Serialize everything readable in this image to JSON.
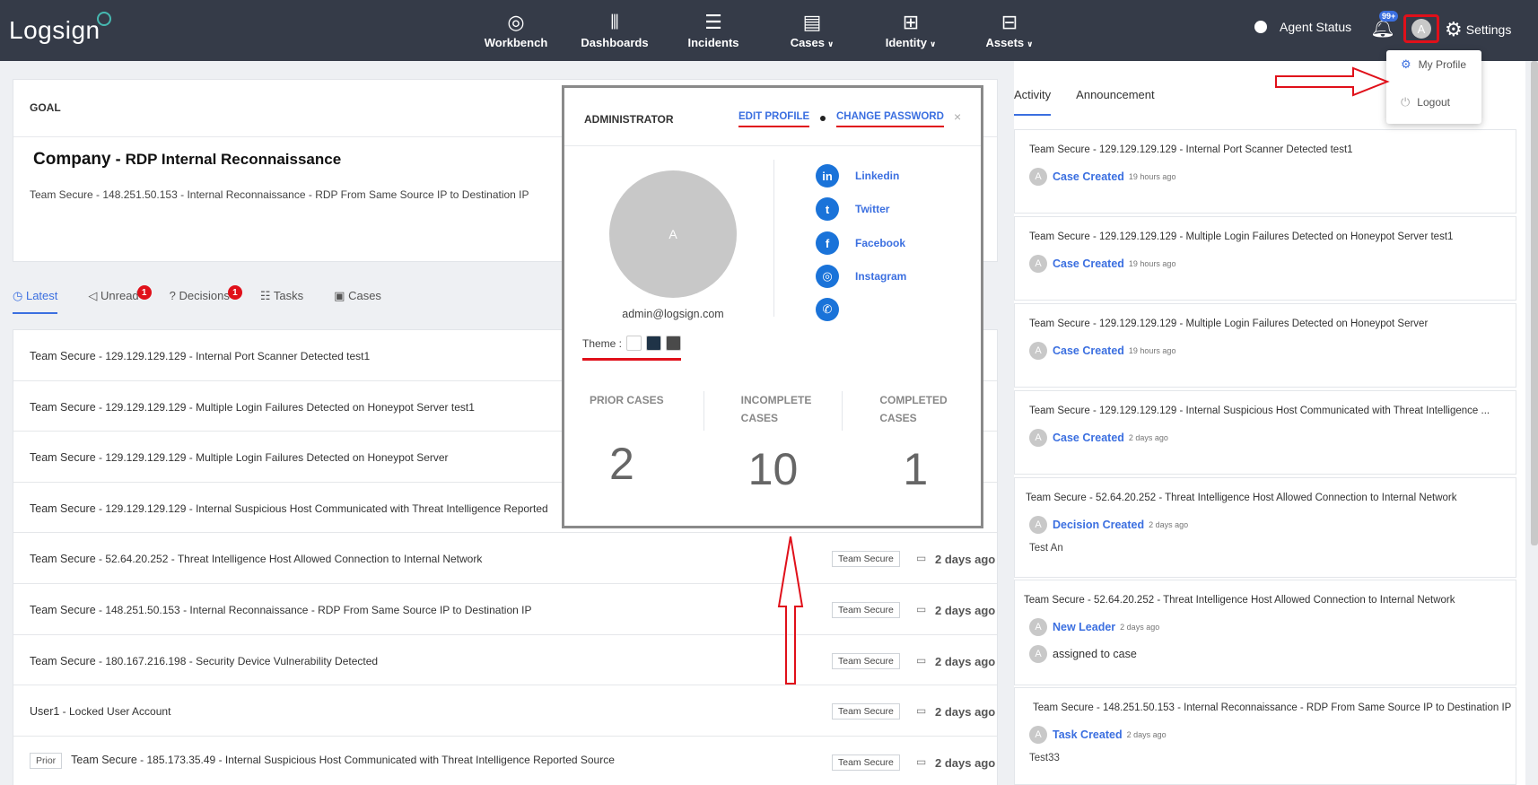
{
  "brand": {
    "logo": "Logsign"
  },
  "nav": [
    {
      "label": "Workbench",
      "icon": "speedometer-icon",
      "glyph": "◎",
      "dropdown": false
    },
    {
      "label": "Dashboards",
      "icon": "bar-chart-icon",
      "glyph": "⫴",
      "dropdown": false
    },
    {
      "label": "Incidents",
      "icon": "list-icon",
      "glyph": "☰",
      "dropdown": false
    },
    {
      "label": "Cases",
      "icon": "file-cabinet-icon",
      "glyph": "▤",
      "dropdown": true
    },
    {
      "label": "Identity",
      "icon": "network-icon",
      "glyph": "⊞",
      "dropdown": true
    },
    {
      "label": "Assets",
      "icon": "grid-icon",
      "glyph": "⊟",
      "dropdown": true
    }
  ],
  "header": {
    "agent_status": "Agent Status",
    "notifications_badge": "99+",
    "avatar_letter": "A",
    "settings": "Settings"
  },
  "dropdown": {
    "my_profile": "My Profile",
    "logout": "Logout"
  },
  "goal": {
    "heading": "GOAL",
    "title_company": "Company",
    "title_dash": " - ",
    "title_rest": "RDP Internal Reconnaissance",
    "desc_org": "Team Secure",
    "desc_rest": " - 148.251.50.153 - Internal Reconnaissance - RDP From Same Source IP to Destination IP"
  },
  "tabs": [
    {
      "label": "Latest",
      "icon": "clock-icon",
      "glyph": "◷",
      "badge": ""
    },
    {
      "label": "Unread",
      "icon": "megaphone-icon",
      "glyph": "◁",
      "badge": "1"
    },
    {
      "label": "Decisions",
      "icon": "question-icon",
      "glyph": "?",
      "badge": "1"
    },
    {
      "label": "Tasks",
      "icon": "tasks-icon",
      "glyph": "☷",
      "badge": ""
    },
    {
      "label": "Cases",
      "icon": "case-icon",
      "glyph": "▣",
      "badge": ""
    }
  ],
  "rows": [
    {
      "prefix": "",
      "org": "Team Secure",
      "rest": " - 129.129.129.129 - Internal Port Scanner Detected test1",
      "tag": "",
      "age": ""
    },
    {
      "prefix": "",
      "org": "Team Secure",
      "rest": " - 129.129.129.129 - Multiple Login Failures Detected on Honeypot Server test1",
      "tag": "",
      "age": ""
    },
    {
      "prefix": "",
      "org": "Team Secure",
      "rest": " - 129.129.129.129 - Multiple Login Failures Detected on Honeypot Server",
      "tag": "",
      "age": ""
    },
    {
      "prefix": "",
      "org": "Team Secure",
      "rest": " - 129.129.129.129 - Internal Suspicious Host Communicated with Threat Intelligence Reported",
      "tag": "",
      "age": ""
    },
    {
      "prefix": "",
      "org": "Team Secure",
      "rest": " - 52.64.20.252 - Threat Intelligence Host Allowed Connection to Internal Network",
      "tag": "Team Secure",
      "age": "2 days ago"
    },
    {
      "prefix": "",
      "org": "Team Secure",
      "rest": " - 148.251.50.153 - Internal Reconnaissance - RDP From Same Source IP to Destination IP",
      "tag": "Team Secure",
      "age": "2 days ago"
    },
    {
      "prefix": "",
      "org": "Team Secure",
      "rest": " - 180.167.216.198 - Security Device Vulnerability Detected",
      "tag": "Team Secure",
      "age": "2 days ago"
    },
    {
      "prefix": "",
      "org": "User1",
      "rest": " - Locked User Account",
      "tag": "Team Secure",
      "age": "2 days ago"
    },
    {
      "prefix": "Prior",
      "org": "Team Secure",
      "rest": "  - 185.173.35.49 - Internal Suspicious Host Communicated with Threat Intelligence Reported Source",
      "tag": "Team Secure",
      "age": "2 days ago"
    }
  ],
  "right_tabs": {
    "activity": "Activity",
    "announcement": "Announcement"
  },
  "activities": [
    {
      "title": "Team Secure - 129.129.129.129 - Internal Port Scanner Detected test1",
      "event": "Case Created",
      "time": "19 hours ago",
      "note": "",
      "assign": ""
    },
    {
      "title": "Team Secure - 129.129.129.129 - Multiple Login Failures Detected on Honeypot Server test1",
      "event": "Case Created",
      "time": "19 hours ago",
      "note": "",
      "assign": ""
    },
    {
      "title": "Team Secure - 129.129.129.129 - Multiple Login Failures Detected on Honeypot Server",
      "event": "Case Created",
      "time": "19 hours ago",
      "note": "",
      "assign": ""
    },
    {
      "title": "Team Secure - 129.129.129.129 - Internal Suspicious Host Communicated with Threat Intelligence ...",
      "event": "Case Created",
      "time": "2 days ago",
      "note": "",
      "assign": ""
    },
    {
      "title": "Team Secure - 52.64.20.252 - Threat Intelligence Host Allowed Connection to Internal Network",
      "event": "Decision Created",
      "time": "2 days ago",
      "note": "Test An",
      "assign": ""
    },
    {
      "title": "Team Secure  - 52.64.20.252 - Threat Intelligence Host Allowed Connection to Internal Network",
      "event": "New Leader",
      "time": "2 days ago",
      "note": "",
      "assign": "assigned to case"
    },
    {
      "title": "Team Secure - 148.251.50.153 - Internal Reconnaissance - RDP From Same Source IP to Destination IP",
      "event": "Task Created",
      "time": "2 days ago",
      "note": "Test33",
      "assign": ""
    }
  ],
  "profile": {
    "role": "ADMINISTRATOR",
    "edit_profile": "EDIT PROFILE",
    "change_password": "CHANGE PASSWORD",
    "close": "×",
    "avatar_letter": "A",
    "email": "admin@logsign.com",
    "theme_label": "Theme :",
    "theme_colors": [
      "#ffffff",
      "#1f3347",
      "#4a4a4a"
    ],
    "social": [
      {
        "label": "Linkedin",
        "icon": "linkedin-icon",
        "glyph": "in"
      },
      {
        "label": "Twitter",
        "icon": "twitter-icon",
        "glyph": "t"
      },
      {
        "label": "Facebook",
        "icon": "facebook-icon",
        "glyph": "f"
      },
      {
        "label": "Instagram",
        "icon": "instagram-icon",
        "glyph": "◎"
      },
      {
        "label": "",
        "icon": "whatsapp-icon",
        "glyph": "✆"
      }
    ],
    "stats": [
      {
        "label_1": "PRIOR CASES",
        "label_2": "",
        "value": "2"
      },
      {
        "label_1": "INCOMPLETE",
        "label_2": "CASES",
        "value": "10"
      },
      {
        "label_1": "COMPLETED",
        "label_2": "CASES",
        "value": "1"
      }
    ]
  },
  "colors": {
    "topbar": "#353b48",
    "accent": "#3b6fe0",
    "highlight": "#e0101a",
    "badge": "#e0101a"
  }
}
